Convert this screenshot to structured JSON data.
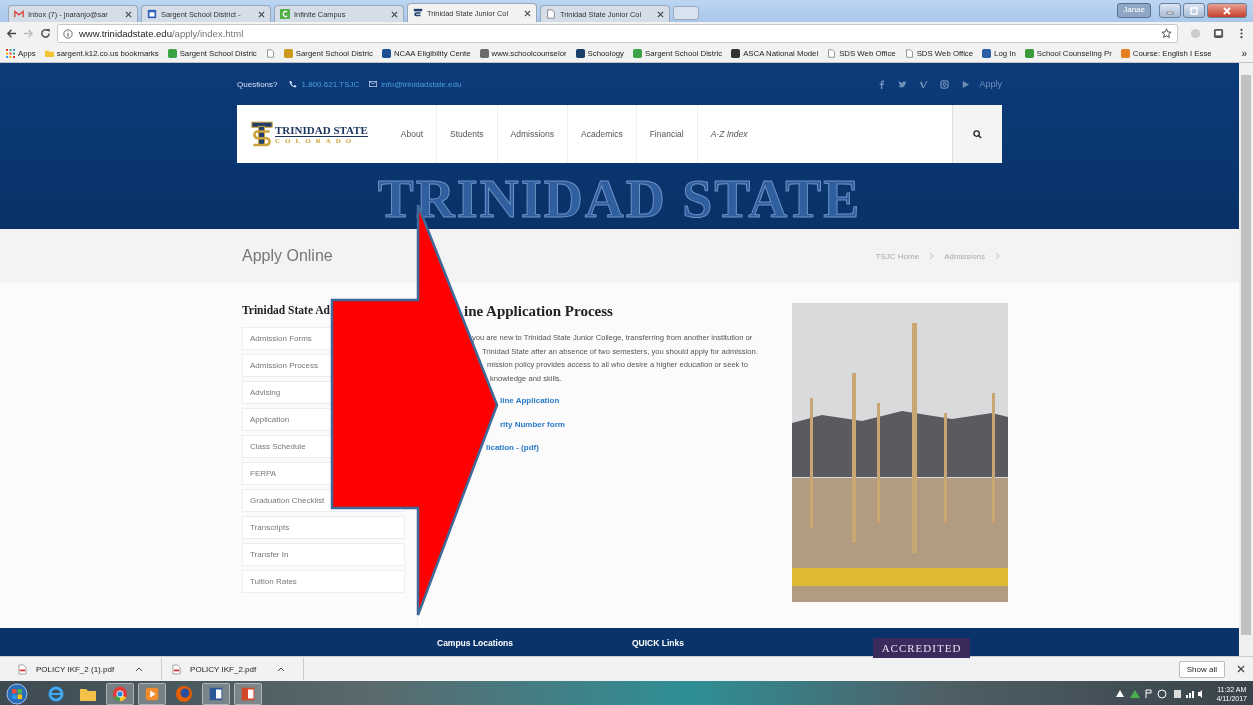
{
  "browser": {
    "tabs": [
      {
        "title": "Inbox (7) - jnaranjo@sar",
        "kind": "mail",
        "selected": false
      },
      {
        "title": "Sargent School District -",
        "kind": "calendar",
        "selected": false
      },
      {
        "title": "Infinite Campus",
        "kind": "campus",
        "selected": false
      },
      {
        "title": "Trinidad State Junior Col",
        "kind": "crest",
        "selected": true
      },
      {
        "title": "Trinidad State Junior Col",
        "kind": "page",
        "selected": false
      }
    ],
    "user": "Janae",
    "address": {
      "host": "www.trinidadstate.edu",
      "path": "/apply/index.html"
    },
    "bookmarks": [
      {
        "label": "Apps",
        "kind": "apps"
      },
      {
        "label": "sargent.k12.co.us bookmarks",
        "kind": "folder"
      },
      {
        "label": "Sargent School Distric",
        "kind": "site",
        "color": "#3aa447"
      },
      {
        "kind": "page"
      },
      {
        "label": "Sargent School Distric",
        "kind": "site",
        "color": "#c99a1c"
      },
      {
        "label": "NCAA Eligibility Cente",
        "kind": "site",
        "color": "#1d4f91"
      },
      {
        "label": "www.schoolcounselor",
        "kind": "site",
        "color": "#6b6b6b"
      },
      {
        "label": "Schoology",
        "kind": "site",
        "color": "#1b3f6b"
      },
      {
        "label": "Sargent School Distric",
        "kind": "site",
        "color": "#3aa447"
      },
      {
        "label": "ASCA National Model",
        "kind": "site",
        "color": "#333333"
      },
      {
        "label": "SDS Web Office",
        "kind": "page"
      },
      {
        "label": "SDS Web Office",
        "kind": "page"
      },
      {
        "label": "Log In",
        "kind": "site",
        "color": "#2a5fa8"
      },
      {
        "label": "School Counseling Pr",
        "kind": "site",
        "color": "#3b9a3b"
      },
      {
        "label": "Course: English I Esse",
        "kind": "site",
        "color": "#e67e22"
      }
    ],
    "more": "»"
  },
  "site": {
    "top_bar": {
      "question": "Questions?",
      "phone": "1.800.621.TSJC",
      "email": "info@trinidadstate.edu",
      "apply": "Apply"
    },
    "logo": {
      "name": "TRINIDAD STATE",
      "state": "COLORADO"
    },
    "nav": [
      {
        "label": "About",
        "kind": "plain"
      },
      {
        "label": "Students",
        "kind": "plain"
      },
      {
        "label": "Admissions",
        "kind": "plain"
      },
      {
        "label": "Academics",
        "kind": "plain"
      },
      {
        "label": "Financial",
        "kind": "plain"
      },
      {
        "label": "A-Z Index",
        "kind": "index"
      }
    ],
    "hero_text": "TRINIDAD STATE",
    "page_title": "Apply Online",
    "breadcrumbs": [
      "TSJC Home",
      "Admissions"
    ],
    "sidebar": {
      "heading": "Trinidad State Ad",
      "items": [
        "Admission Forms",
        "Admission Process",
        "Advising",
        "Application",
        "Class Schedule",
        "FERPA",
        "Graduation Checklist",
        "Transcripts",
        "Transfer In",
        "Tuition Rates"
      ]
    },
    "content": {
      "heading": "ine Application Process",
      "lines": [
        "you are new to Trinidad State Junior College, transferring from another institution or",
        "Trinidad State after an absence of two semesters, you should apply for admission.",
        "mission policy provides access to all who desire a higher education or seek to",
        "knowledge and skills."
      ],
      "links": [
        "line Application",
        "rity Number form",
        "lication - (pdf)"
      ]
    },
    "footer": {
      "columns": [
        "Campus Locations",
        "QUICK Links"
      ],
      "badge": "ACCREDITED"
    }
  },
  "downloads": {
    "files": [
      "POLICY IKF_2 (1).pdf",
      "POLICY IKF_2.pdf"
    ],
    "show_all": "Show all"
  },
  "taskbar": {
    "apps": [
      {
        "kind": "ie"
      },
      {
        "kind": "explorer"
      },
      {
        "kind": "chrome"
      },
      {
        "kind": "media"
      },
      {
        "kind": "firefox"
      },
      {
        "kind": "word"
      },
      {
        "kind": "powerpoint"
      }
    ],
    "time": "11:32 AM",
    "date": "4/11/2017"
  }
}
